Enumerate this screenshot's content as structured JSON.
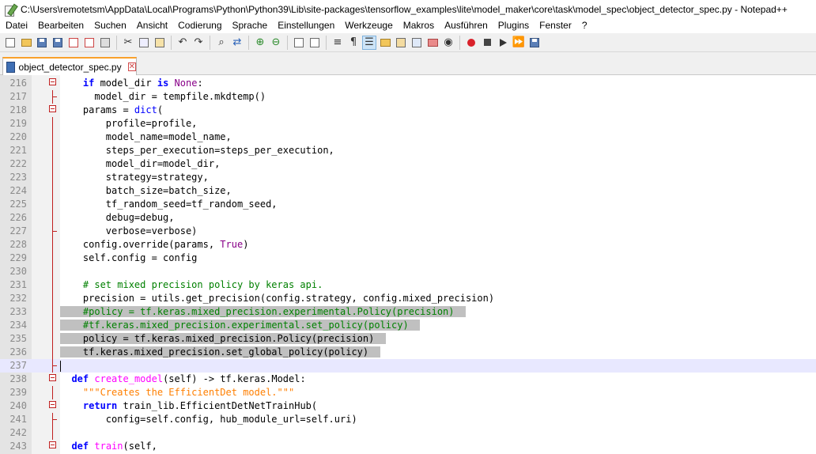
{
  "window": {
    "title": "C:\\Users\\remotetsm\\AppData\\Local\\Programs\\Python\\Python39\\Lib\\site-packages\\tensorflow_examples\\lite\\model_maker\\core\\task\\model_spec\\object_detector_spec.py - Notepad++"
  },
  "menu": [
    {
      "label": "Datei"
    },
    {
      "label": "Bearbeiten"
    },
    {
      "label": "Suchen"
    },
    {
      "label": "Ansicht"
    },
    {
      "label": "Codierung"
    },
    {
      "label": "Sprache"
    },
    {
      "label": "Einstellungen"
    },
    {
      "label": "Werkzeuge"
    },
    {
      "label": "Makros"
    },
    {
      "label": "Ausführen"
    },
    {
      "label": "Plugins"
    },
    {
      "label": "Fenster"
    },
    {
      "label": "?"
    }
  ],
  "toolbar_icons": [
    "new-file-icon",
    "open-file-icon",
    "save-icon",
    "save-all-icon",
    "close-icon",
    "close-all-icon",
    "print-icon",
    "cut-icon",
    "copy-icon",
    "paste-icon",
    "undo-icon",
    "redo-icon",
    "find-icon",
    "replace-icon",
    "zoom-in-icon",
    "zoom-out-icon",
    "sync-vertical-icon",
    "sync-horizontal-icon",
    "word-wrap-icon",
    "show-all-chars-icon",
    "indent-guide-icon",
    "user-lang-icon",
    "doc-map-icon",
    "function-list-icon",
    "folder-as-workspace-icon",
    "monitoring-icon",
    "record-macro-icon",
    "stop-record-icon",
    "playback-macro-icon",
    "run-macro-multiple-icon",
    "save-macro-icon"
  ],
  "tab": {
    "label": "object_detector_spec.py"
  },
  "colors": {
    "keyword": "#0000ff",
    "constant": "#880088",
    "comment": "#008000",
    "docstring": "#ff7f00",
    "function_name": "#ff00ff",
    "selection": "#c0c0c0",
    "current_line": "#e8e8ff",
    "fold_marker": "#c02020"
  },
  "editor": {
    "lines": [
      {
        "num": "216",
        "text": "    if model_dir is None:"
      },
      {
        "num": "217",
        "text": "      model_dir = tempfile.mkdtemp()"
      },
      {
        "num": "218",
        "text": "    params = dict("
      },
      {
        "num": "219",
        "text": "        profile=profile,"
      },
      {
        "num": "220",
        "text": "        model_name=model_name,"
      },
      {
        "num": "221",
        "text": "        steps_per_execution=steps_per_execution,"
      },
      {
        "num": "222",
        "text": "        model_dir=model_dir,"
      },
      {
        "num": "223",
        "text": "        strategy=strategy,"
      },
      {
        "num": "224",
        "text": "        batch_size=batch_size,"
      },
      {
        "num": "225",
        "text": "        tf_random_seed=tf_random_seed,"
      },
      {
        "num": "226",
        "text": "        debug=debug,"
      },
      {
        "num": "227",
        "text": "        verbose=verbose)"
      },
      {
        "num": "228",
        "text": "    config.override(params, True)"
      },
      {
        "num": "229",
        "text": "    self.config = config"
      },
      {
        "num": "230",
        "text": ""
      },
      {
        "num": "231",
        "text": "    # set mixed precision policy by keras api."
      },
      {
        "num": "232",
        "text": "    precision = utils.get_precision(config.strategy, config.mixed_precision)"
      },
      {
        "num": "233",
        "text": "    #policy = tf.keras.mixed_precision.experimental.Policy(precision)"
      },
      {
        "num": "234",
        "text": "    #tf.keras.mixed_precision.experimental.set_policy(policy)"
      },
      {
        "num": "235",
        "text": "    policy = tf.keras.mixed_precision.Policy(precision)"
      },
      {
        "num": "236",
        "text": "    tf.keras.mixed_precision.set_global_policy(policy)"
      },
      {
        "num": "237",
        "text": ""
      },
      {
        "num": "238",
        "text": "  def create_model(self) -> tf.keras.Model:"
      },
      {
        "num": "239",
        "text": "    \"\"\"Creates the EfficientDet model.\"\"\""
      },
      {
        "num": "240",
        "text": "    return train_lib.EfficientDetNetTrainHub("
      },
      {
        "num": "241",
        "text": "        config=self.config, hub_module_url=self.uri)"
      },
      {
        "num": "242",
        "text": ""
      },
      {
        "num": "243",
        "text": "  def train(self,"
      }
    ]
  }
}
